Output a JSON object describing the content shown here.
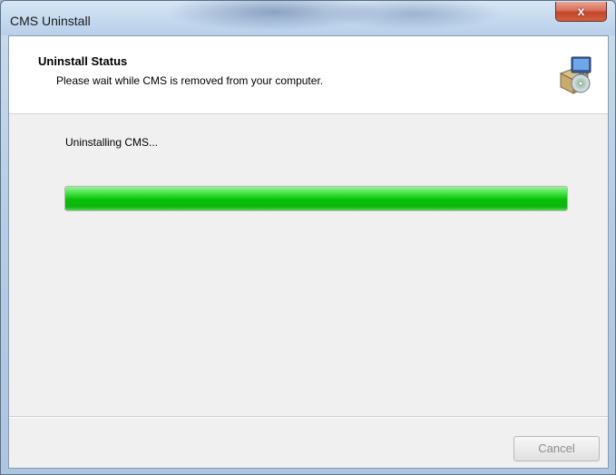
{
  "window": {
    "title": "CMS Uninstall",
    "close_label": "x"
  },
  "header": {
    "title": "Uninstall Status",
    "subtitle": "Please wait while CMS is removed from your computer.",
    "icon": "installer-package-icon"
  },
  "main": {
    "status_text": "Uninstalling CMS...",
    "progress_fraction": 1.0,
    "progress_color": "#12c012"
  },
  "footer": {
    "cancel_label": "Cancel",
    "cancel_enabled": false
  }
}
